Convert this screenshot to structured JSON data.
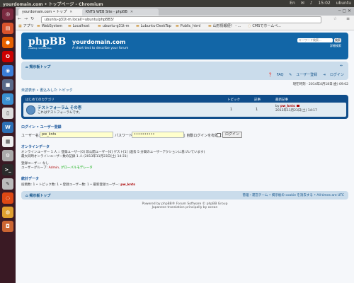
{
  "topbar": {
    "title": "yourdomain.com • トップページ - Chromium",
    "kbd": "En",
    "mail": "✉",
    "vol": "♪",
    "time": "15:02",
    "user": "ubuntu"
  },
  "tabs": [
    {
      "label": "yourdomain.com • トップ"
    },
    {
      "label": "KNTS WEB Site - phpBB"
    },
    {
      "label": ""
    }
  ],
  "address": {
    "url": "ubuntu-g31t-m.local/~ubuntu/phpBB3/"
  },
  "bookmarks": [
    {
      "label": "アプリ"
    },
    {
      "label": "WebSystem"
    },
    {
      "label": "Localhost"
    },
    {
      "label": "ubuntu-g31t-m"
    },
    {
      "label": "Lubuntu-DeskTop"
    },
    {
      "label": "Public_html"
    },
    {
      "label": "山形情報便！ - ..."
    },
    {
      "label": "CMSでホームペ..."
    }
  ],
  "header": {
    "logo": "phpBB",
    "logo_sub": "creating communities",
    "site_name": "yourdomain.com",
    "site_desc": "A short text to describe your forum",
    "search_placeholder": "キーワード検索...",
    "search_button": "検索",
    "adv_search": "詳細検索"
  },
  "navbar": {
    "crumb": "掲示板トップ",
    "resize": "⇔",
    "faq": "FAQ",
    "register": "ユーザー登録",
    "login": "ログイン"
  },
  "dates": {
    "current": "現在時刻 - 2014年4月18日(金) 09:02"
  },
  "unread_links": "未読表示 • 書込みした トピック",
  "forum": {
    "category": "はじめてのカテゴリ",
    "col_topics": "トピック",
    "col_posts": "記事",
    "col_last": "最新記事",
    "row": {
      "title": "テストフォーラム その壱",
      "desc": "これはテストフォーラムです。",
      "topics": "1",
      "posts": "1",
      "last_by_prefix": "by",
      "last_by": "pw_knts",
      "last_date": "2013年11月23日(土) 14:17"
    }
  },
  "login": {
    "heading": "ログイン • ユーザー登録",
    "user_label": "ユーザー名:",
    "user_value": "pw_knts",
    "pass_label": "パスワード:",
    "pass_value": "••••••••••",
    "auto_login": "| 自動ログインを有効にする",
    "button": "ログイン"
  },
  "online": {
    "heading": "オンラインデータ",
    "line1": "オンラインユーザー 1 人 :: 登録ユーザー[0] 非公開ユーザー[0] ゲスト[1] (過去 5 分間のユーザーアクションに基づいています)",
    "line2": "最大同時オンラインユーザー数の記録 1 人 (2013年11月23日(土) 14:31)",
    "line3": "登録ユーザー: なし",
    "groups_label": "ユーザーグループ:",
    "group1": "Admin",
    "group2": "グローバルモデレータ"
  },
  "stats": {
    "heading": "統計データ",
    "text": "投稿数: 1 • トピック数: 1 • 登録ユーザー数: 1 • 最新登録ユーザー:",
    "newest": "pw_knts"
  },
  "footer": {
    "left": "掲示板トップ",
    "right": "管理・運営チーム • 掲示板の cookie を消去する • All times are UTC",
    "copy1": "Powered by phpBB® Forum Software © phpBB Group",
    "copy2": "Japanese translation principally by ocean"
  }
}
